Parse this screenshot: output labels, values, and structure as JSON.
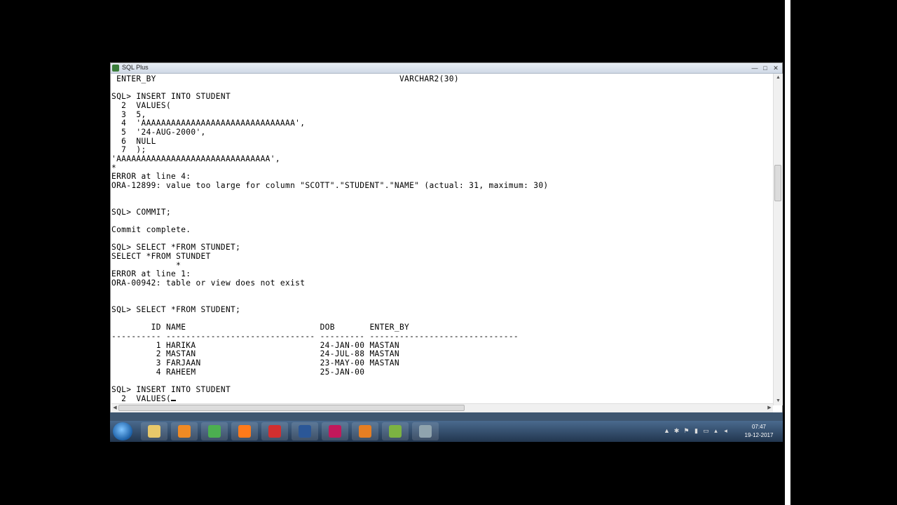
{
  "window": {
    "title": "SQL Plus",
    "min_glyph": "—",
    "max_glyph": "□",
    "close_glyph": "✕"
  },
  "console": {
    "lines": [
      " ENTER_BY                                                 VARCHAR2(30)",
      "",
      "SQL> INSERT INTO STUDENT",
      "  2  VALUES(",
      "  3  5,",
      "  4  'AAAAAAAAAAAAAAAAAAAAAAAAAAAAAAA',",
      "  5  '24-AUG-2000',",
      "  6  NULL",
      "  7  );",
      "'AAAAAAAAAAAAAAAAAAAAAAAAAAAAAAA',",
      "*",
      "ERROR at line 4:",
      "ORA-12899: value too large for column \"SCOTT\".\"STUDENT\".\"NAME\" (actual: 31, maximum: 30)",
      "",
      "",
      "SQL> COMMIT;",
      "",
      "Commit complete.",
      "",
      "SQL> SELECT *FROM STUNDET;",
      "SELECT *FROM STUNDET",
      "             *",
      "ERROR at line 1:",
      "ORA-00942: table or view does not exist",
      "",
      "",
      "SQL> SELECT *FROM STUDENT;",
      "",
      "        ID NAME                           DOB       ENTER_BY",
      "---------- ------------------------------ --------- ------------------------------",
      "         1 HARIKA                         24-JAN-00 MASTAN",
      "         2 MASTAN                         24-JUL-88 MASTAN",
      "         3 FARJAAN                        23-MAY-00 MASTAN",
      "         4 RAHEEM                         25-JAN-00",
      "",
      "SQL> INSERT INTO STUDENT",
      "  2  VALUES("
    ]
  },
  "taskbar": {
    "apps": [
      {
        "name": "file-explorer",
        "color": "#e8c86a"
      },
      {
        "name": "media-player",
        "color": "#f08a24"
      },
      {
        "name": "chrome",
        "color": "#4caf50"
      },
      {
        "name": "firefox",
        "color": "#ff7a1a"
      },
      {
        "name": "acrobat",
        "color": "#d32f2f"
      },
      {
        "name": "word",
        "color": "#2b5797"
      },
      {
        "name": "database-tool",
        "color": "#c2185b"
      },
      {
        "name": "settings",
        "color": "#e67e22"
      },
      {
        "name": "network-tool",
        "color": "#7cb342"
      },
      {
        "name": "sql-plus",
        "color": "#90a4ae"
      }
    ],
    "clock_time": "07:47",
    "clock_date": "19-12-2017"
  }
}
